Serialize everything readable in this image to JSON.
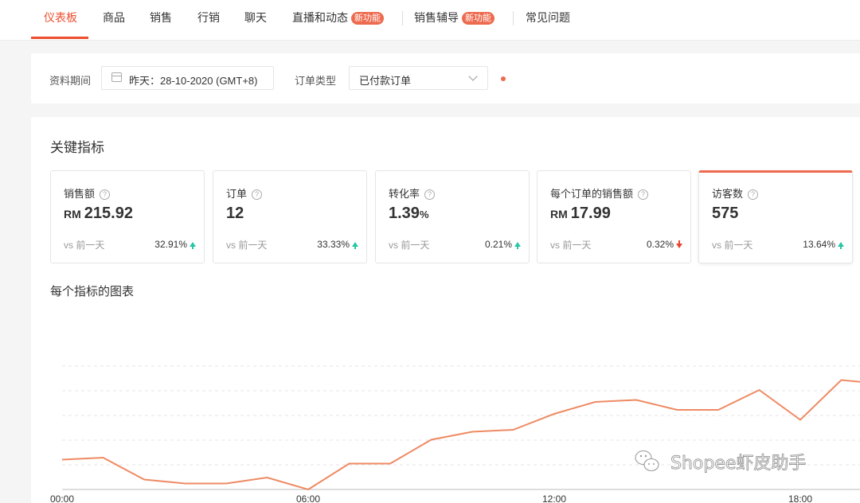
{
  "nav": {
    "items": [
      {
        "label": "仪表板",
        "badge": ""
      },
      {
        "label": "商品",
        "badge": ""
      },
      {
        "label": "销售",
        "badge": ""
      },
      {
        "label": "行销",
        "badge": ""
      },
      {
        "label": "聊天",
        "badge": ""
      },
      {
        "label": "直播和动态",
        "badge": "新功能"
      },
      {
        "label": "销售辅导",
        "badge": "新功能"
      },
      {
        "label": "常见问题",
        "badge": ""
      }
    ]
  },
  "filters": {
    "period_label": "资料期间",
    "period_value": "昨天：28-10-2020 (GMT+8)",
    "order_type_label": "订单类型",
    "order_type_value": "已付款订单"
  },
  "key_metrics": {
    "title": "关键指标",
    "cards": [
      {
        "label": "销售额",
        "prefix": "RM",
        "value": "215.92",
        "suffix": "",
        "vs": "vs 前一天",
        "delta": "32.91%",
        "trend": "up"
      },
      {
        "label": "订单",
        "prefix": "",
        "value": "12",
        "suffix": "",
        "vs": "vs 前一天",
        "delta": "33.33%",
        "trend": "up"
      },
      {
        "label": "转化率",
        "prefix": "",
        "value": "1.39",
        "suffix": "%",
        "vs": "vs 前一天",
        "delta": "0.21%",
        "trend": "up"
      },
      {
        "label": "每个订单的销售额",
        "prefix": "RM",
        "value": "17.99",
        "suffix": "",
        "vs": "vs 前一天",
        "delta": "0.32%",
        "trend": "down"
      },
      {
        "label": "访客数",
        "prefix": "",
        "value": "575",
        "suffix": "",
        "vs": "vs 前一天",
        "delta": "13.64%",
        "trend": "up"
      }
    ]
  },
  "chart_section": {
    "title": "每个指标的图表",
    "watermark": "Shopee虾皮助手"
  },
  "colors": {
    "accent": "#ee4d2d",
    "line": "#ee8a63",
    "up": "#26c6a6",
    "down": "#e8442e"
  },
  "chart_data": {
    "type": "line",
    "x_ticks": [
      "00:00",
      "06:00",
      "12:00",
      "18:00"
    ],
    "x": [
      "00:00",
      "01:00",
      "02:00",
      "03:00",
      "04:00",
      "05:00",
      "06:00",
      "07:00",
      "08:00",
      "09:00",
      "10:00",
      "11:00",
      "12:00",
      "13:00",
      "14:00",
      "15:00",
      "16:00",
      "17:00",
      "18:00",
      "19:00",
      "20:00"
    ],
    "series": [
      {
        "name": "访客数",
        "values": [
          15,
          16,
          5,
          3,
          3,
          6,
          0,
          13,
          13,
          25,
          29,
          30,
          38,
          44,
          45,
          40,
          40,
          50,
          35,
          55,
          53
        ]
      }
    ],
    "ylim": [
      0,
      90
    ],
    "grid": true
  }
}
